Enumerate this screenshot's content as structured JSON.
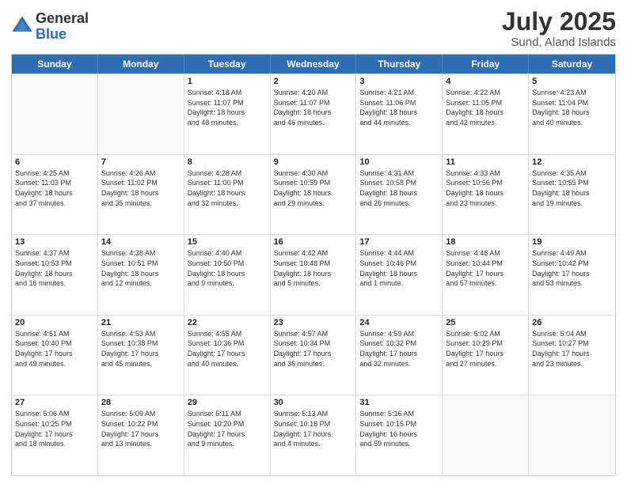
{
  "logo": {
    "general": "General",
    "blue": "Blue"
  },
  "header": {
    "title": "July 2025",
    "subtitle": "Sund, Aland Islands"
  },
  "days": [
    "Sunday",
    "Monday",
    "Tuesday",
    "Wednesday",
    "Thursday",
    "Friday",
    "Saturday"
  ],
  "weeks": [
    [
      {
        "day": "",
        "info": ""
      },
      {
        "day": "",
        "info": ""
      },
      {
        "day": "1",
        "info": "Sunrise: 4:18 AM\nSunset: 11:07 PM\nDaylight: 18 hours\nand 48 minutes."
      },
      {
        "day": "2",
        "info": "Sunrise: 4:20 AM\nSunset: 11:07 PM\nDaylight: 18 hours\nand 46 minutes."
      },
      {
        "day": "3",
        "info": "Sunrise: 4:21 AM\nSunset: 11:06 PM\nDaylight: 18 hours\nand 44 minutes."
      },
      {
        "day": "4",
        "info": "Sunrise: 4:22 AM\nSunset: 11:05 PM\nDaylight: 18 hours\nand 42 minutes."
      },
      {
        "day": "5",
        "info": "Sunrise: 4:23 AM\nSunset: 11:04 PM\nDaylight: 18 hours\nand 40 minutes."
      }
    ],
    [
      {
        "day": "6",
        "info": "Sunrise: 4:25 AM\nSunset: 11:03 PM\nDaylight: 18 hours\nand 37 minutes."
      },
      {
        "day": "7",
        "info": "Sunrise: 4:26 AM\nSunset: 11:02 PM\nDaylight: 18 hours\nand 35 minutes."
      },
      {
        "day": "8",
        "info": "Sunrise: 4:28 AM\nSunset: 11:00 PM\nDaylight: 18 hours\nand 32 minutes."
      },
      {
        "day": "9",
        "info": "Sunrise: 4:30 AM\nSunset: 10:59 PM\nDaylight: 18 hours\nand 29 minutes."
      },
      {
        "day": "10",
        "info": "Sunrise: 4:31 AM\nSunset: 10:58 PM\nDaylight: 18 hours\nand 26 minutes."
      },
      {
        "day": "11",
        "info": "Sunrise: 4:33 AM\nSunset: 10:56 PM\nDaylight: 18 hours\nand 23 minutes."
      },
      {
        "day": "12",
        "info": "Sunrise: 4:35 AM\nSunset: 10:55 PM\nDaylight: 18 hours\nand 19 minutes."
      }
    ],
    [
      {
        "day": "13",
        "info": "Sunrise: 4:37 AM\nSunset: 10:53 PM\nDaylight: 18 hours\nand 16 minutes."
      },
      {
        "day": "14",
        "info": "Sunrise: 4:38 AM\nSunset: 10:51 PM\nDaylight: 18 hours\nand 12 minutes."
      },
      {
        "day": "15",
        "info": "Sunrise: 4:40 AM\nSunset: 10:50 PM\nDaylight: 18 hours\nand 9 minutes."
      },
      {
        "day": "16",
        "info": "Sunrise: 4:42 AM\nSunset: 10:48 PM\nDaylight: 18 hours\nand 5 minutes."
      },
      {
        "day": "17",
        "info": "Sunrise: 4:44 AM\nSunset: 10:46 PM\nDaylight: 18 hours\nand 1 minute."
      },
      {
        "day": "18",
        "info": "Sunrise: 4:46 AM\nSunset: 10:44 PM\nDaylight: 17 hours\nand 57 minutes."
      },
      {
        "day": "19",
        "info": "Sunrise: 4:49 AM\nSunset: 10:42 PM\nDaylight: 17 hours\nand 53 minutes."
      }
    ],
    [
      {
        "day": "20",
        "info": "Sunrise: 4:51 AM\nSunset: 10:40 PM\nDaylight: 17 hours\nand 49 minutes."
      },
      {
        "day": "21",
        "info": "Sunrise: 4:53 AM\nSunset: 10:38 PM\nDaylight: 17 hours\nand 45 minutes."
      },
      {
        "day": "22",
        "info": "Sunrise: 4:55 AM\nSunset: 10:36 PM\nDaylight: 17 hours\nand 40 minutes."
      },
      {
        "day": "23",
        "info": "Sunrise: 4:57 AM\nSunset: 10:34 PM\nDaylight: 17 hours\nand 36 minutes."
      },
      {
        "day": "24",
        "info": "Sunrise: 4:59 AM\nSunset: 10:32 PM\nDaylight: 17 hours\nand 32 minutes."
      },
      {
        "day": "25",
        "info": "Sunrise: 5:02 AM\nSunset: 10:29 PM\nDaylight: 17 hours\nand 27 minutes."
      },
      {
        "day": "26",
        "info": "Sunrise: 5:04 AM\nSunset: 10:27 PM\nDaylight: 17 hours\nand 23 minutes."
      }
    ],
    [
      {
        "day": "27",
        "info": "Sunrise: 5:06 AM\nSunset: 10:25 PM\nDaylight: 17 hours\nand 18 minutes."
      },
      {
        "day": "28",
        "info": "Sunrise: 5:09 AM\nSunset: 10:22 PM\nDaylight: 17 hours\nand 13 minutes."
      },
      {
        "day": "29",
        "info": "Sunrise: 5:11 AM\nSunset: 10:20 PM\nDaylight: 17 hours\nand 9 minutes."
      },
      {
        "day": "30",
        "info": "Sunrise: 5:13 AM\nSunset: 10:18 PM\nDaylight: 17 hours\nand 4 minutes."
      },
      {
        "day": "31",
        "info": "Sunrise: 5:16 AM\nSunset: 10:15 PM\nDaylight: 16 hours\nand 59 minutes."
      },
      {
        "day": "",
        "info": ""
      },
      {
        "day": "",
        "info": ""
      }
    ]
  ]
}
